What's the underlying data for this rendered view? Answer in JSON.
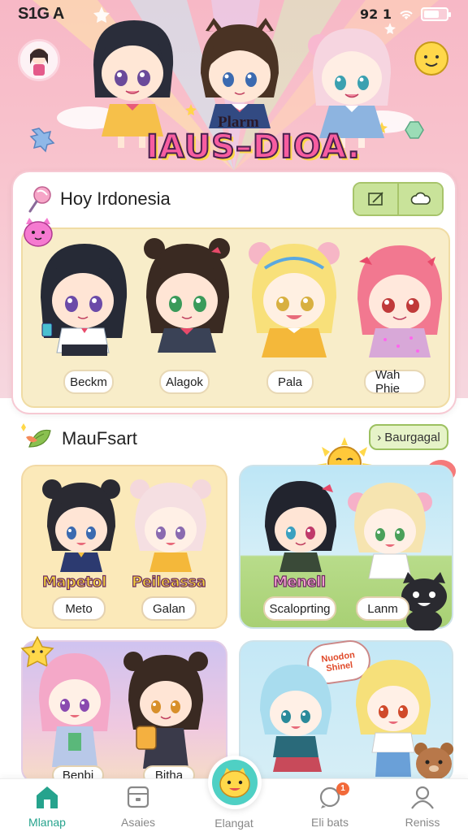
{
  "status_bar": {
    "left": "S1G A",
    "right": "92 1"
  },
  "hero": {
    "title_small": "Plarm",
    "title": "IAUS–DIOA."
  },
  "section1": {
    "title": "Hoy Irdonesia"
  },
  "friends": [
    {
      "name": "Beckm"
    },
    {
      "name": "Alagok"
    },
    {
      "name": "Pala"
    },
    {
      "name": "Wah Phie"
    }
  ],
  "section2": {
    "title": "MauFsart",
    "button": "Baurgagal"
  },
  "rooms": [
    {
      "title1": "Mapetol",
      "title2": "Peileassa",
      "pill1": "Meto",
      "pill2": "Galan"
    },
    {
      "title": "Menell",
      "pill1": "Scaloprting",
      "pill2": "Lanm"
    },
    {
      "pill1": "Benbi",
      "pill2": "Bitha"
    },
    {
      "bubble": "Nuodon Shinel"
    }
  ],
  "bottom_nav": [
    {
      "label": "Mlanap"
    },
    {
      "label": "Asaies"
    },
    {
      "label": "Elangat"
    },
    {
      "label": "Eli bats",
      "badge": "1"
    },
    {
      "label": "Reniss"
    }
  ],
  "colors": {
    "accent": "#26a38d",
    "pink": "#f7b8c6",
    "green": "#c9e39a"
  }
}
